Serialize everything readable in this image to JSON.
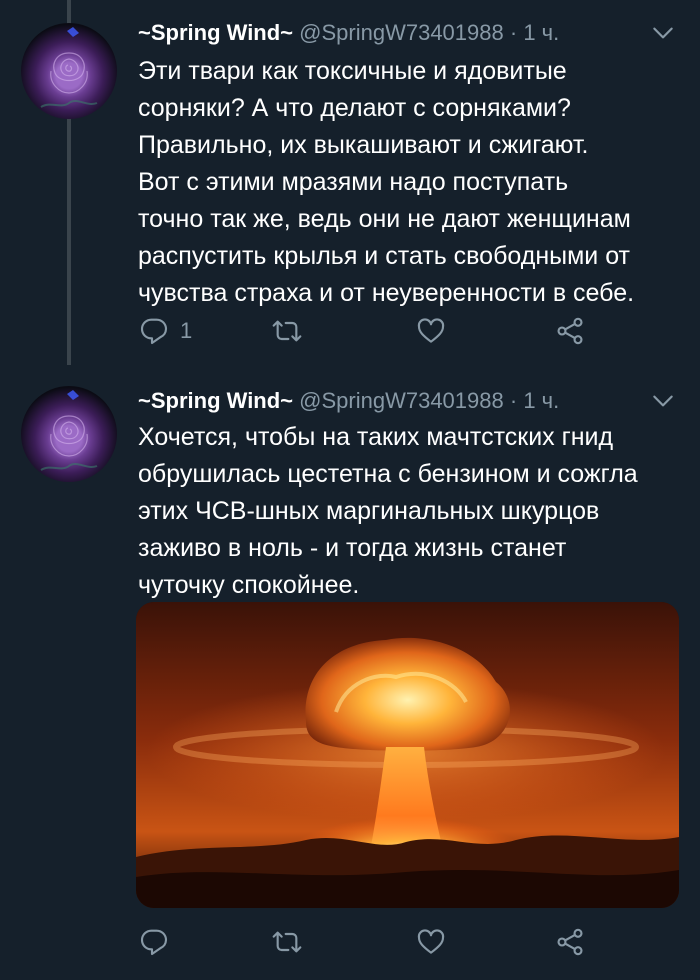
{
  "tweets": [
    {
      "author_name": "~Spring Wind~",
      "handle": "@SpringW73401988",
      "separator": "·",
      "time": "1 ч.",
      "text": "Эти твари как токсичные и ядовитые\nсорняки? А что делают с сорняками?\nПравильно, их выкашивают и сжигают.\nВот с этими мразями надо поступать\nточно так же, ведь они не дают женщинам\nраспустить крылья и стать свободными от\nчувства страха и от неуверенности в себе.",
      "reply_count": "1",
      "icons": [
        "avatar-rose",
        "chevron-down-icon",
        "reply-icon",
        "retweet-icon",
        "like-icon",
        "share-icon"
      ]
    },
    {
      "author_name": "~Spring Wind~",
      "handle": "@SpringW73401988",
      "separator": "·",
      "time": "1 ч.",
      "text": "Хочется, чтобы на таких мачтстских гнид\nобрушилась цестетна с бензином и сожгла\nэтих ЧСВ-шных маргинальных шкурцов\nзаживо в ноль - и тогда жизнь станет\nчуточку спокойнее.",
      "media": "mushroom-cloud-explosion",
      "icons": [
        "avatar-rose",
        "chevron-down-icon",
        "reply-icon",
        "retweet-icon",
        "like-icon",
        "share-icon"
      ]
    }
  ],
  "colors": {
    "background": "#15202b",
    "text": "#ffffff",
    "secondary": "#8899a6",
    "thread_line": "#3a444c"
  }
}
